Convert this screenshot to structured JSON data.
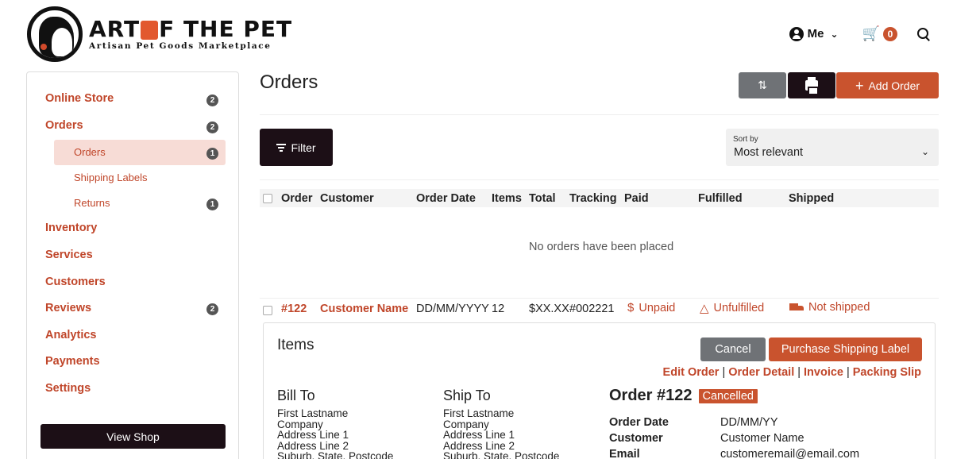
{
  "header": {
    "brand_title_part1": "ART ",
    "brand_title_part2": "F THE PET",
    "brand_subtitle": "Artisan Pet Goods Marketplace",
    "user_label": "Me",
    "cart_count": "0"
  },
  "sidebar": {
    "items": [
      {
        "label": "Online Store",
        "badge": "2"
      },
      {
        "label": "Orders",
        "badge": "2"
      },
      {
        "label": "Inventory",
        "badge": ""
      },
      {
        "label": "Services",
        "badge": ""
      },
      {
        "label": "Customers",
        "badge": ""
      },
      {
        "label": "Reviews",
        "badge": "2"
      },
      {
        "label": "Analytics",
        "badge": ""
      },
      {
        "label": "Payments",
        "badge": ""
      },
      {
        "label": "Settings",
        "badge": ""
      }
    ],
    "sub_items": [
      {
        "label": "Orders",
        "badge": "1"
      },
      {
        "label": "Shipping Labels",
        "badge": ""
      },
      {
        "label": "Returns",
        "badge": "1"
      }
    ],
    "view_shop_label": "View Shop"
  },
  "main": {
    "title": "Orders",
    "add_order_label": "Add Order",
    "filter_label": "Filter",
    "sort_by_label": "Sort by",
    "sort_by_value": "Most relevant",
    "columns": [
      "Order",
      "Customer",
      "Order Date",
      "Items",
      "Total",
      "Tracking",
      "Paid",
      "Fulfilled",
      "Shipped"
    ],
    "empty_message": "No orders have been placed",
    "row": {
      "order": "#122",
      "customer": "Customer Name",
      "date": "DD/MM/YYYY",
      "items": "12",
      "total": "$XX.XX",
      "tracking": "#002221",
      "paid": "Unpaid",
      "fulfilled": "Unfulfilled",
      "shipped": "Not shipped"
    }
  },
  "detail": {
    "items_title": "Items",
    "cancel_label": "Cancel",
    "purchase_label": "Purchase Shipping Label",
    "links": [
      "Edit Order",
      "Order Detail",
      "Invoice",
      "Packing Slip"
    ],
    "bill_to": {
      "title": "Bill To",
      "lines": [
        "First Lastname",
        "Company",
        "Address Line 1",
        "Address Line 2",
        "Suburb, State, Postcode"
      ]
    },
    "ship_to": {
      "title": "Ship To",
      "lines": [
        "First Lastname",
        "Company",
        "Address Line 1",
        "Address Line 2",
        "Suburb, State, Postcode"
      ]
    },
    "order_title": "Order #122",
    "status_badge": "Cancelled",
    "order_date_label": "Order Date",
    "order_date_value": "DD/MM/YY",
    "customer_label": "Customer",
    "customer_value": "Customer Name",
    "email_label": "Email",
    "email_value": "customeremail@email.com"
  },
  "colors": {
    "accent": "#c9532e",
    "dark": "#1c0f16",
    "grey_button": "#6f7276",
    "active_bg": "#f7dcd6"
  }
}
